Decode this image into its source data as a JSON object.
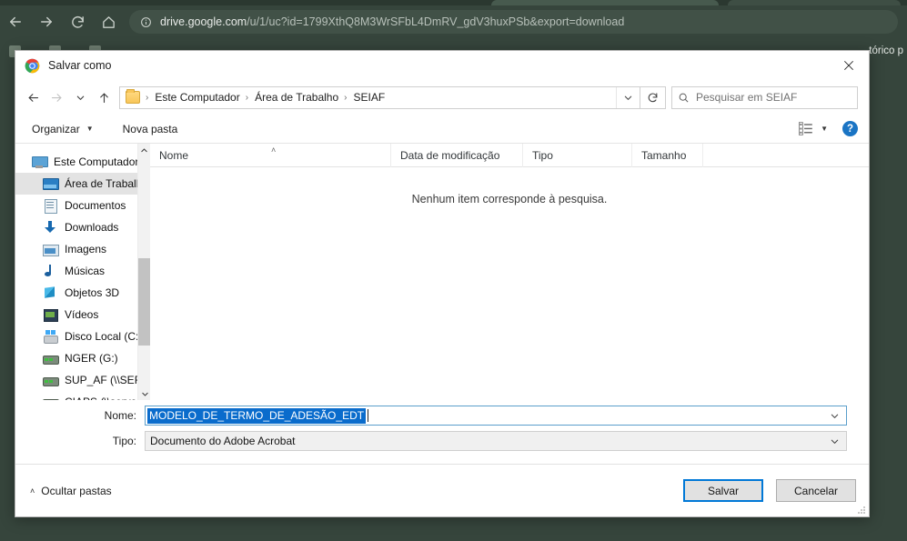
{
  "browser": {
    "url_prefix": "drive.google.com",
    "url_suffix": "/u/1/uc?id=1799XthQ8M3WrSFbL4DmRV_gdV3huxPSb&export=download",
    "back_icon": "back-arrow-icon",
    "forward_icon": "forward-arrow-icon",
    "reload_icon": "reload-icon",
    "home_icon": "home-icon",
    "info_icon": "site-info-icon",
    "bookmark_right_label": "tórico p"
  },
  "dialog": {
    "title": "Salvar como",
    "close_label": "✕",
    "app_icon": "chrome-logo-icon"
  },
  "address": {
    "back_icon": "back-arrow-icon",
    "forward_icon": "forward-arrow-icon",
    "recent_icon": "recent-locations-icon",
    "up_icon": "up-arrow-icon",
    "folder_icon": "folder-icon",
    "crumbs": [
      "Este Computador",
      "Área de Trabalho",
      "SEIAF"
    ],
    "separator": "›",
    "dropdown_icon": "chevron-down-icon",
    "refresh_icon": "refresh-icon",
    "search_icon": "search-icon",
    "search_placeholder": "Pesquisar em SEIAF"
  },
  "toolbar": {
    "organizar_label": "Organizar",
    "organizar_caret": "▼",
    "nova_pasta_label": "Nova pasta",
    "view_icon": "view-mode-icon",
    "view_caret": "▼",
    "help_icon": "help-icon",
    "help_glyph": "?"
  },
  "nav_pane": {
    "items": [
      {
        "label": "Este Computador",
        "icon": "computer-icon",
        "icon_class": "ic-pc",
        "indent": false,
        "selected": false
      },
      {
        "label": "Área de Trabalho",
        "icon": "desktop-icon",
        "icon_class": "ic-desk",
        "indent": true,
        "selected": true
      },
      {
        "label": "Documentos",
        "icon": "documents-icon",
        "icon_class": "ic-doc",
        "indent": true,
        "selected": false
      },
      {
        "label": "Downloads",
        "icon": "downloads-icon",
        "icon_class": "ic-dl",
        "indent": true,
        "selected": false
      },
      {
        "label": "Imagens",
        "icon": "pictures-icon",
        "icon_class": "ic-img",
        "indent": true,
        "selected": false
      },
      {
        "label": "Músicas",
        "icon": "music-icon",
        "icon_class": "ic-mus",
        "indent": true,
        "selected": false
      },
      {
        "label": "Objetos 3D",
        "icon": "3d-objects-icon",
        "icon_class": "ic-3d",
        "indent": true,
        "selected": false
      },
      {
        "label": "Vídeos",
        "icon": "videos-icon",
        "icon_class": "ic-vid",
        "indent": true,
        "selected": false
      },
      {
        "label": "Disco Local (C:)",
        "icon": "local-disk-icon",
        "icon_class": "ic-disk",
        "indent": true,
        "selected": false
      },
      {
        "label": "NGER (G:)",
        "icon": "network-drive-icon",
        "icon_class": "ic-net",
        "indent": true,
        "selected": false
      },
      {
        "label": "SUP_AF (\\\\SERVE",
        "icon": "network-drive-icon",
        "icon_class": "ic-net",
        "indent": true,
        "selected": false
      },
      {
        "label": "CIAPS (\\\\servera",
        "icon": "network-drive-icon",
        "icon_class": "ic-net",
        "indent": true,
        "selected": false
      }
    ],
    "scroll_up_icon": "chevron-up-icon",
    "scroll_down_icon": "chevron-down-icon"
  },
  "file_list": {
    "columns": [
      "Nome",
      "Data de modificação",
      "Tipo",
      "Tamanho"
    ],
    "sort_indicator": "˄",
    "empty_message": "Nenhum item corresponde à pesquisa.",
    "rows": []
  },
  "form": {
    "name_label": "Nome:",
    "name_value": "MODELO_DE_TERMO_DE_ADESÃO_EDT",
    "name_selected": true,
    "name_dropdown_icon": "chevron-down-icon",
    "type_label": "Tipo:",
    "type_value": "Documento do Adobe Acrobat",
    "type_dropdown_icon": "chevron-down-icon",
    "selection_color": "#0a6ccc"
  },
  "footer": {
    "hide_folders_label": "Ocultar pastas",
    "hide_folders_caret": "˄",
    "save_label": "Salvar",
    "cancel_label": "Cancelar",
    "accent_color": "#0078d7",
    "resize_grip_icon": "resize-grip-icon"
  }
}
